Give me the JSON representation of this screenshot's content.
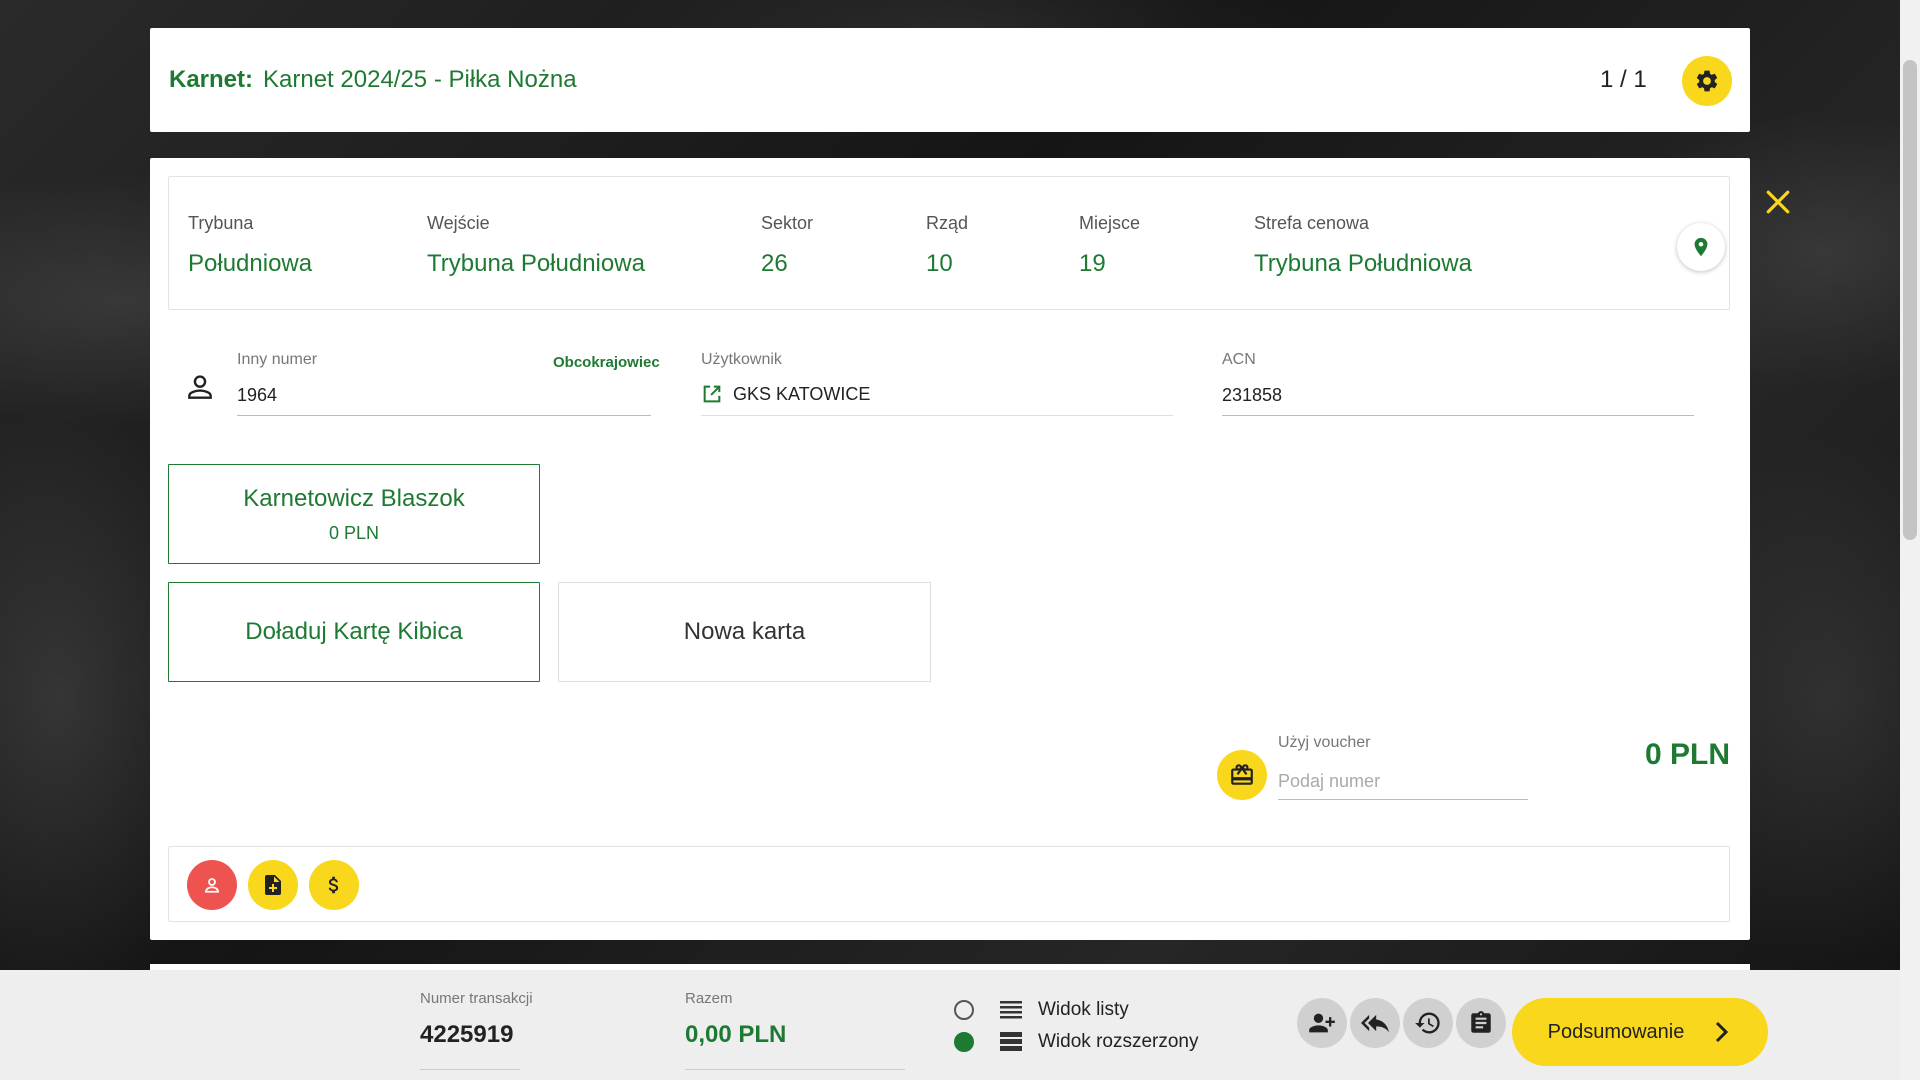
{
  "header": {
    "label": "Karnet:",
    "title": "Karnet 2024/25 - Piłka Nożna",
    "pager": "1 / 1"
  },
  "seat": {
    "trybuna_label": "Trybuna",
    "trybuna_value": "Południowa",
    "wejscie_label": "Wejście",
    "wejscie_value": "Trybuna Południowa",
    "sektor_label": "Sektor",
    "sektor_value": "26",
    "rzad_label": "Rząd",
    "rzad_value": "10",
    "miejsce_label": "Miejsce",
    "miejsce_value": "19",
    "strefa_label": "Strefa cenowa",
    "strefa_value": "Trybuna Południowa"
  },
  "fields": {
    "other_number_label": "Inny numer",
    "other_number_value": "1964",
    "foreigner_link": "Obcokrajowiec",
    "user_label": "Użytkownik",
    "user_value": "GKS KATOWICE",
    "acn_label": "ACN",
    "acn_value": "231858"
  },
  "tiles": {
    "holder_name": "Karnetowicz Blaszok",
    "holder_price": "0 PLN",
    "topup": "Doładuj Kartę Kibica",
    "new_card": "Nowa karta"
  },
  "voucher": {
    "label": "Użyj voucher",
    "placeholder": "Podaj numer",
    "total": "0 PLN"
  },
  "bottom": {
    "transaction_label": "Numer transakcji",
    "transaction_value": "4225919",
    "total_label": "Razem",
    "total_value": "0,00 PLN",
    "view_list": "Widok listy",
    "view_extended": "Widok rozszerzony",
    "summary_button": "Podsumowanie"
  },
  "colors": {
    "accent_green": "#1e7a33",
    "accent_yellow": "#f9d71c",
    "danger_red": "#ef5350"
  }
}
